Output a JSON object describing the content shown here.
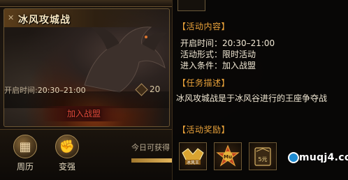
{
  "event_card": {
    "title": "冰风攻城战",
    "open_time_label": "开启时间:",
    "open_time_value": "20:30–21:00",
    "count": "20",
    "join_button": "加入战盟"
  },
  "nav": {
    "calendar_label": "周历",
    "strength_label": "变强"
  },
  "today_text": "今日可获得",
  "tooltip": {
    "activity_content_title": "【活动内容】",
    "open_time": "开启时间：20:30–21:00",
    "format": "活动形式：限时活动",
    "entry": "进入条件：加入战盟",
    "task_title": "【任务描述】",
    "task_desc": "冰风攻城战是于冰风谷进行的王座争夺战",
    "reward_title": "【活动奖励】",
    "rewards": [
      {
        "icon": "king-badge-icon",
        "text": "冰风王"
      },
      {
        "icon": "star-emblem-icon",
        "text": "Mu"
      },
      {
        "icon": "coin-box-icon",
        "text": "5元"
      }
    ]
  },
  "watermark": "muqj4.com"
}
